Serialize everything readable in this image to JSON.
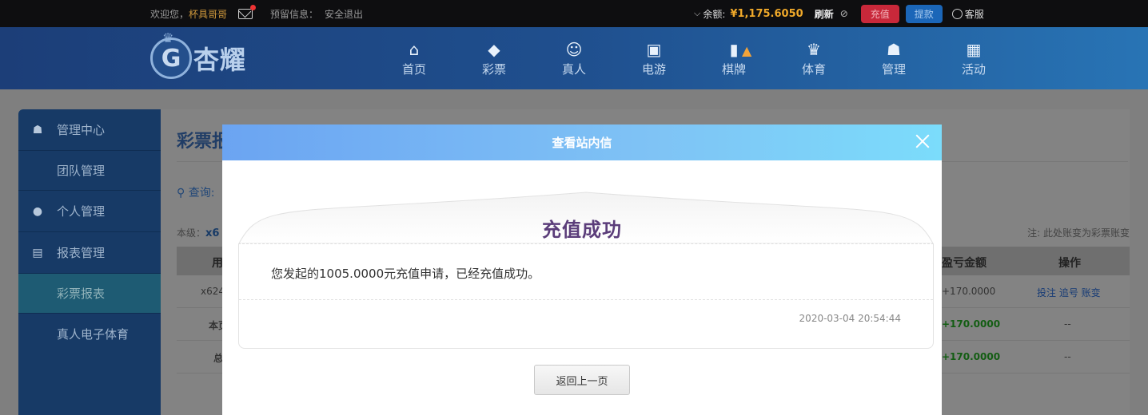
{
  "topbar": {
    "welcome": "欢迎您，",
    "username": "杯具哥哥",
    "reserve_label": "预留信息：",
    "logout": "安全退出",
    "balance_label": "余额:",
    "balance_value": "¥1,175.6050",
    "refresh": "刷新",
    "charge": "充值",
    "withdraw": "提款",
    "service": "客服"
  },
  "header": {
    "logo_text": "杏耀",
    "nav": [
      {
        "label": "首页",
        "icon": "home-icon",
        "glyph": "⌂"
      },
      {
        "label": "彩票",
        "icon": "ticket-icon",
        "glyph": "◆"
      },
      {
        "label": "真人",
        "icon": "person-icon",
        "glyph": "☺"
      },
      {
        "label": "电游",
        "icon": "slot-machine-icon",
        "glyph": "▣"
      },
      {
        "label": "棋牌",
        "icon": "cards-icon",
        "glyph": "▮"
      },
      {
        "label": "体育",
        "icon": "trophy-icon",
        "glyph": "♛"
      },
      {
        "label": "管理",
        "icon": "users-icon",
        "glyph": "☗"
      },
      {
        "label": "活动",
        "icon": "gift-icon",
        "glyph": "▦"
      }
    ]
  },
  "sidebar": {
    "items": [
      {
        "label": "管理中心",
        "icon": "users-icon"
      },
      {
        "label": "团队管理"
      },
      {
        "label": "个人管理",
        "icon": "user-icon"
      },
      {
        "label": "报表管理",
        "icon": "report-icon"
      },
      {
        "label": "彩票报表"
      },
      {
        "label": "真人电子体育"
      }
    ]
  },
  "main": {
    "title": "彩票报",
    "query": "查询:",
    "level_label": "本级：",
    "level_value": "x6",
    "note": "注: 此处账变为彩票账变",
    "col_user": "用",
    "col_profit": "盈亏金额",
    "col_action": "操作",
    "rows": [
      {
        "user": "x624",
        "profit": "+170.0000",
        "action": "投注 追号 账变"
      },
      {
        "user": "本页",
        "profit": "+170.0000",
        "action": "--"
      },
      {
        "user": "总",
        "profit": "+170.0000",
        "action": "--"
      }
    ]
  },
  "modal": {
    "title": "查看站内信",
    "heading": "充值成功",
    "message": "您发起的1005.0000元充值申请，已经充值成功。",
    "time": "2020-03-04 20:54:44",
    "back": "返回上一页"
  }
}
